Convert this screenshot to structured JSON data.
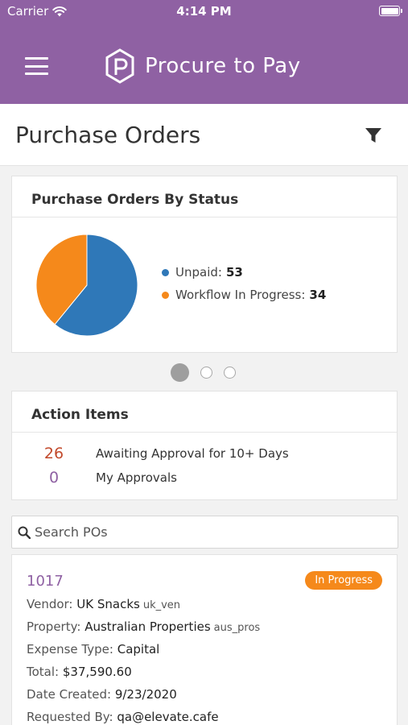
{
  "status_bar": {
    "carrier": "Carrier",
    "time": "4:14 PM"
  },
  "app": {
    "title": "Procure to Pay"
  },
  "page": {
    "title": "Purchase Orders"
  },
  "status_chart": {
    "title": "Purchase Orders By Status",
    "legend": [
      {
        "label": "Unpaid:",
        "value": "53",
        "color": "#2f78b8"
      },
      {
        "label": "Workflow In Progress:",
        "value": "34",
        "color": "#f5891b"
      }
    ]
  },
  "chart_data": {
    "type": "pie",
    "title": "Purchase Orders By Status",
    "categories": [
      "Unpaid",
      "Workflow In Progress"
    ],
    "values": [
      53,
      34
    ],
    "colors": [
      "#2f78b8",
      "#f5891b"
    ]
  },
  "pager": {
    "pages": 3,
    "active": 1
  },
  "action_items": {
    "title": "Action Items",
    "rows": [
      {
        "count": "26",
        "label": "Awaiting Approval for 10+ Days"
      },
      {
        "count": "0",
        "label": "My Approvals"
      }
    ]
  },
  "search": {
    "placeholder": "Search POs"
  },
  "po": {
    "number": "1017",
    "status": "In Progress",
    "vendor_label": "Vendor:",
    "vendor": "UK Snacks",
    "vendor_code": "uk_ven",
    "property_label": "Property:",
    "property": "Australian Properties",
    "property_code": "aus_pros",
    "expense_label": "Expense Type:",
    "expense": "Capital",
    "total_label": "Total:",
    "total": "$37,590.60",
    "date_label": "Date Created:",
    "date": "9/23/2020",
    "requested_label": "Requested By:",
    "requested": "qa@elevate.cafe"
  },
  "colors": {
    "brand": "#8f61a3",
    "accent_orange": "#f5891b",
    "pie_blue": "#2f78b8",
    "alert_red": "#c24a2c"
  }
}
